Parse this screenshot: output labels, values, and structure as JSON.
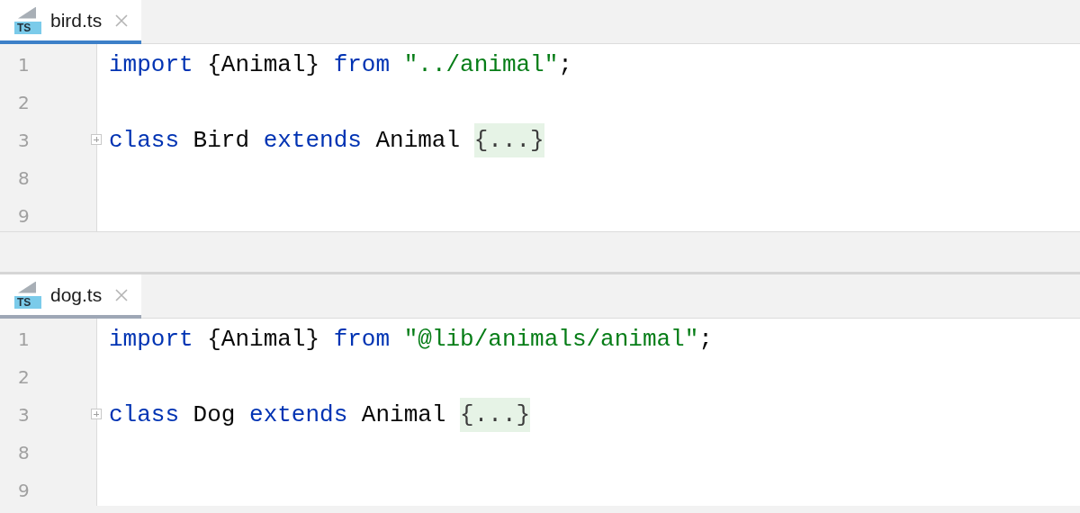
{
  "editors": [
    {
      "tab": {
        "icon_text": "TS",
        "label": "bird.ts",
        "selected": true
      },
      "focused": true,
      "lines": [
        {
          "number": "1",
          "fold": false,
          "tokens": [
            {
              "kind": "keyword",
              "text": "import"
            },
            {
              "kind": "plain",
              "text": " {Animal} "
            },
            {
              "kind": "keyword",
              "text": "from "
            },
            {
              "kind": "string",
              "text": "\"../animal\""
            },
            {
              "kind": "plain",
              "text": ";"
            }
          ]
        },
        {
          "number": "2",
          "fold": false
        },
        {
          "number": "3",
          "fold": true,
          "tokens": [
            {
              "kind": "keyword",
              "text": "class"
            },
            {
              "kind": "plain",
              "text": " Bird "
            },
            {
              "kind": "keyword",
              "text": "extends"
            },
            {
              "kind": "plain",
              "text": " Animal "
            },
            {
              "kind": "folded",
              "text": "{...}"
            }
          ]
        },
        {
          "number": "8",
          "fold": false
        },
        {
          "number": "9",
          "fold": false
        }
      ]
    },
    {
      "tab": {
        "icon_text": "TS",
        "label": "dog.ts",
        "selected": true
      },
      "focused": false,
      "lines": [
        {
          "number": "1",
          "fold": false,
          "tokens": [
            {
              "kind": "keyword",
              "text": "import"
            },
            {
              "kind": "plain",
              "text": " {Animal} "
            },
            {
              "kind": "keyword",
              "text": "from "
            },
            {
              "kind": "string",
              "text": "\"@lib/animals/animal\""
            },
            {
              "kind": "plain",
              "text": ";"
            }
          ]
        },
        {
          "number": "2",
          "fold": false
        },
        {
          "number": "3",
          "fold": true,
          "tokens": [
            {
              "kind": "keyword",
              "text": "class"
            },
            {
              "kind": "plain",
              "text": " Dog "
            },
            {
              "kind": "keyword",
              "text": "extends"
            },
            {
              "kind": "plain",
              "text": " Animal "
            },
            {
              "kind": "folded",
              "text": "{...}"
            }
          ]
        },
        {
          "number": "8",
          "fold": false
        },
        {
          "number": "9",
          "fold": false
        }
      ]
    }
  ]
}
